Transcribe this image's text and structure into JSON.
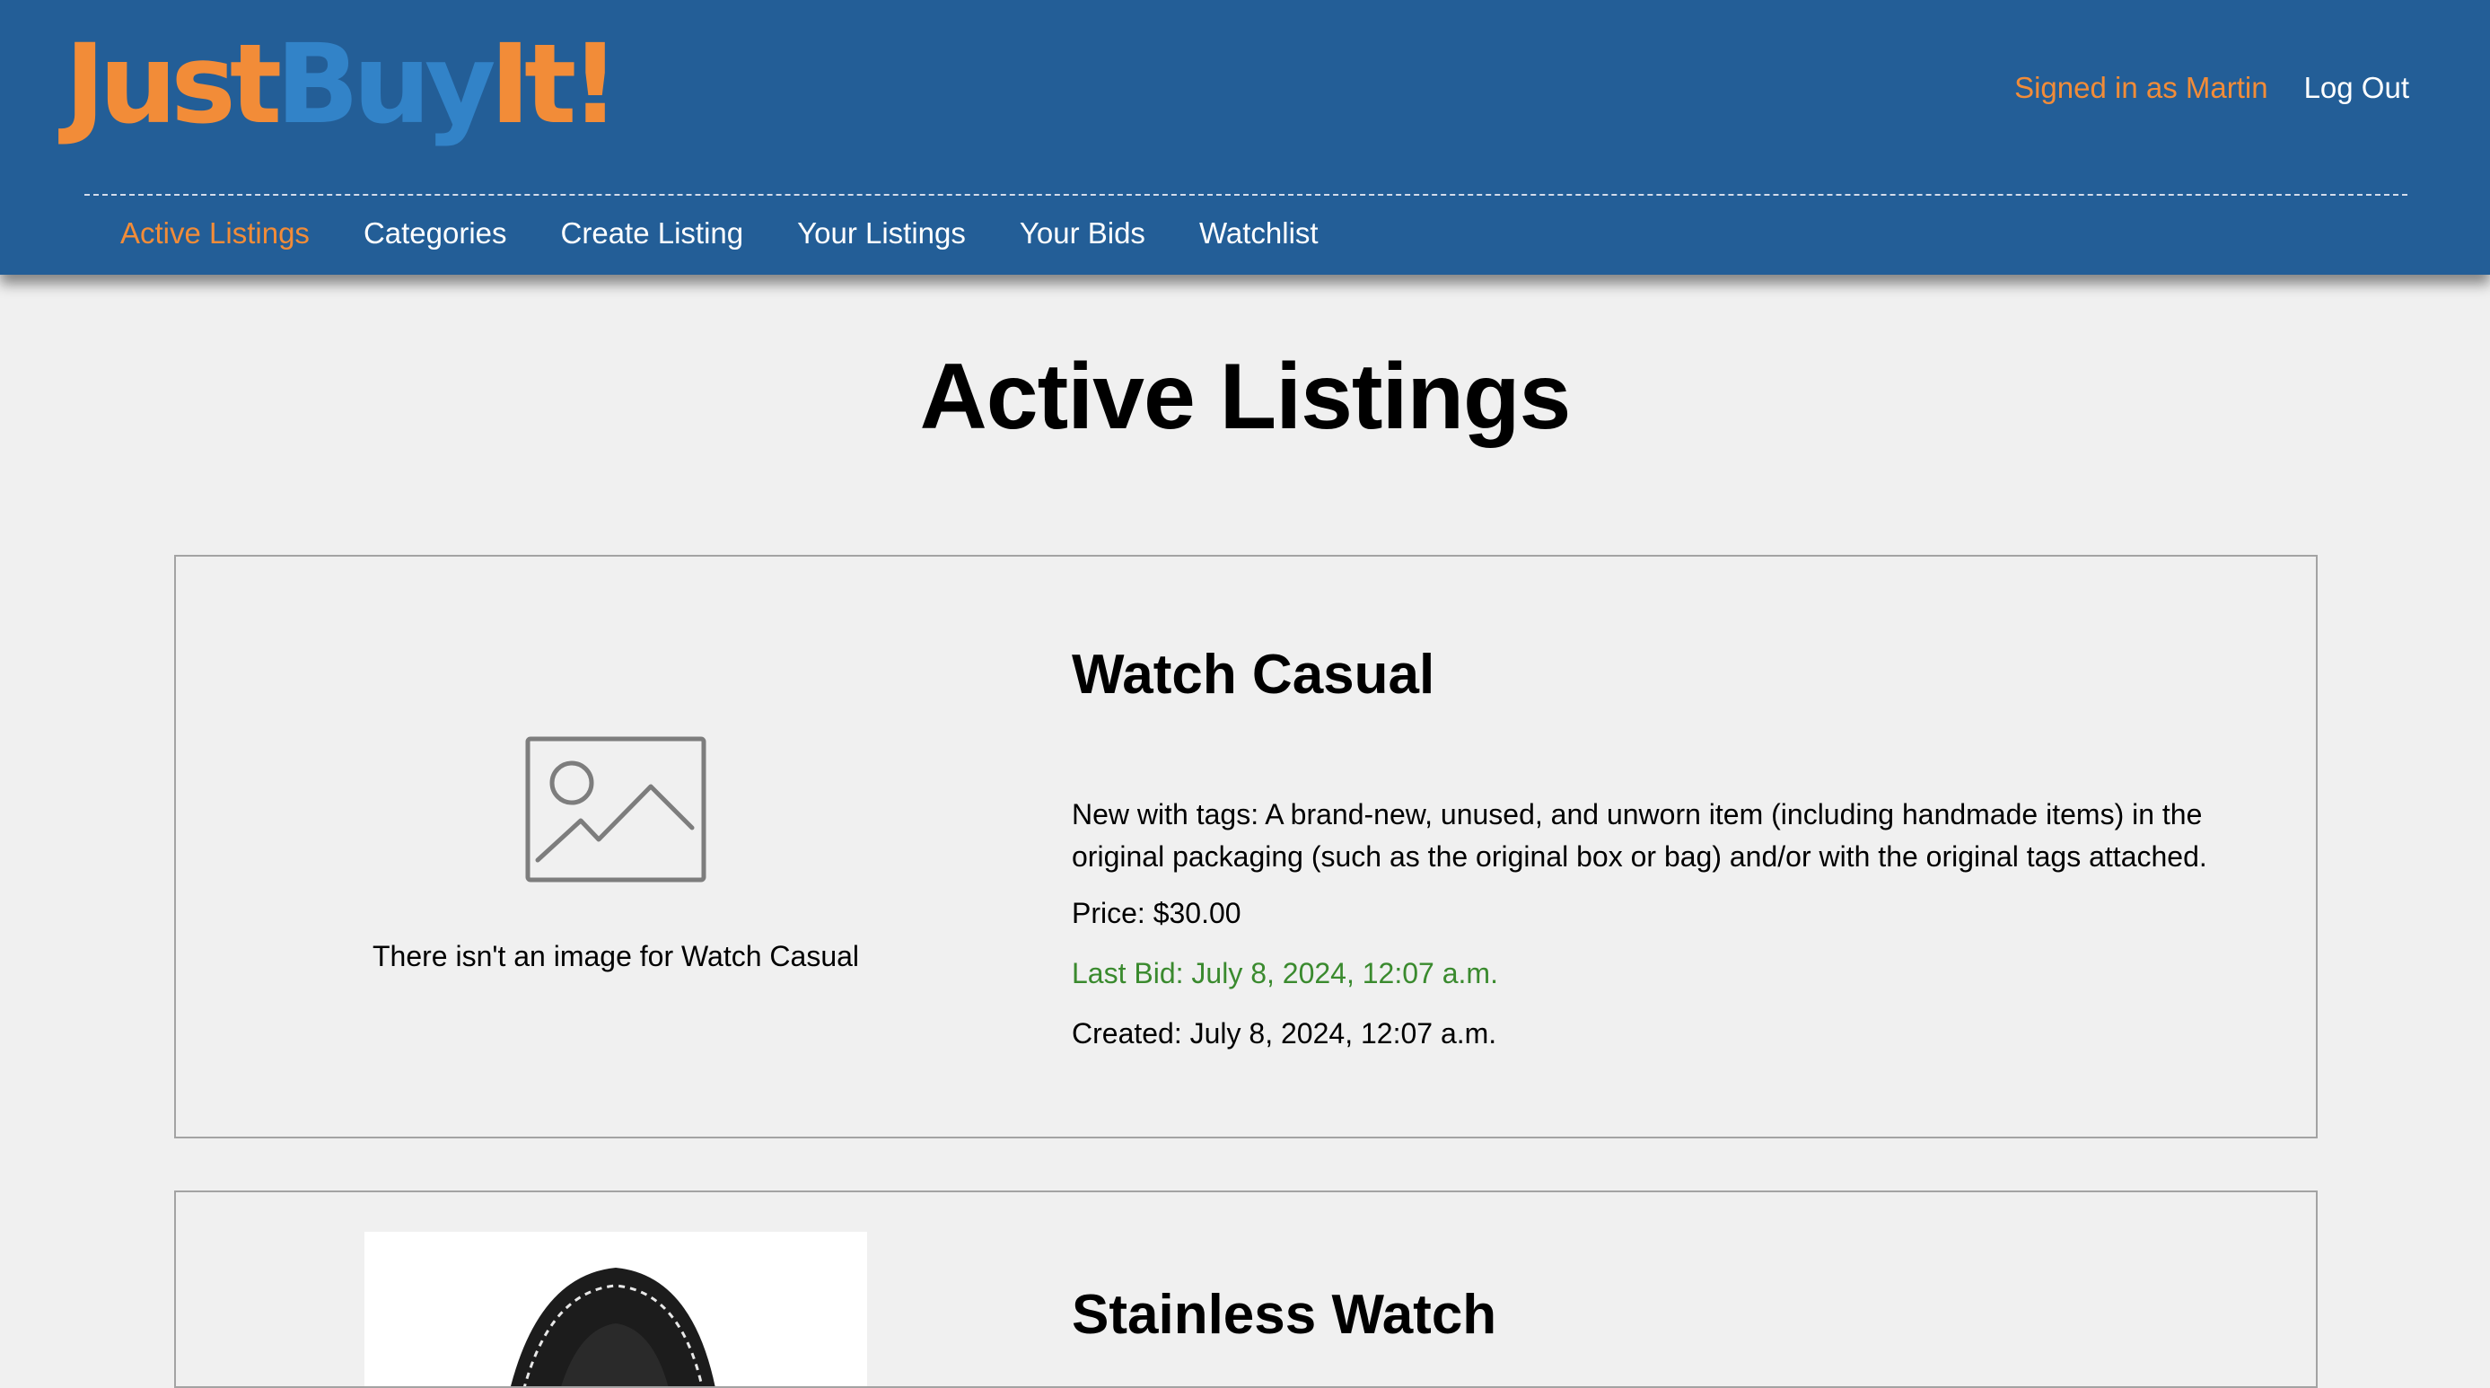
{
  "brand": {
    "logo_part1": "Just",
    "logo_part2": "BuyIt!",
    "color_orange": "#f28c38",
    "color_blue": "#3283c8",
    "header_bg": "#235e97"
  },
  "user_nav": {
    "signed_in": "Signed in as Martin",
    "logout": "Log Out"
  },
  "main_nav": {
    "items": [
      {
        "label": "Active Listings",
        "active": true
      },
      {
        "label": "Categories",
        "active": false
      },
      {
        "label": "Create Listing",
        "active": false
      },
      {
        "label": "Your Listings",
        "active": false
      },
      {
        "label": "Your Bids",
        "active": false
      },
      {
        "label": "Watchlist",
        "active": false
      }
    ]
  },
  "page": {
    "title": "Active Listings"
  },
  "listings": [
    {
      "title": "Watch Casual",
      "image_alt": "There isn't an image for Watch Casual",
      "image_icon": "image-placeholder-icon",
      "description": "New with tags: A brand-new, unused, and unworn item (including handmade items) in the original packaging (such as the original box or bag) and/or with the original tags attached.",
      "price": "Price: $30.00",
      "last_bid": "Last Bid: July 8, 2024, 12:07 a.m.",
      "created": "Created: July 8, 2024, 12:07 a.m.",
      "last_bid_color": "#3a8a2e"
    },
    {
      "title": "Stainless Watch",
      "image": "watch-strap-photo"
    }
  ]
}
